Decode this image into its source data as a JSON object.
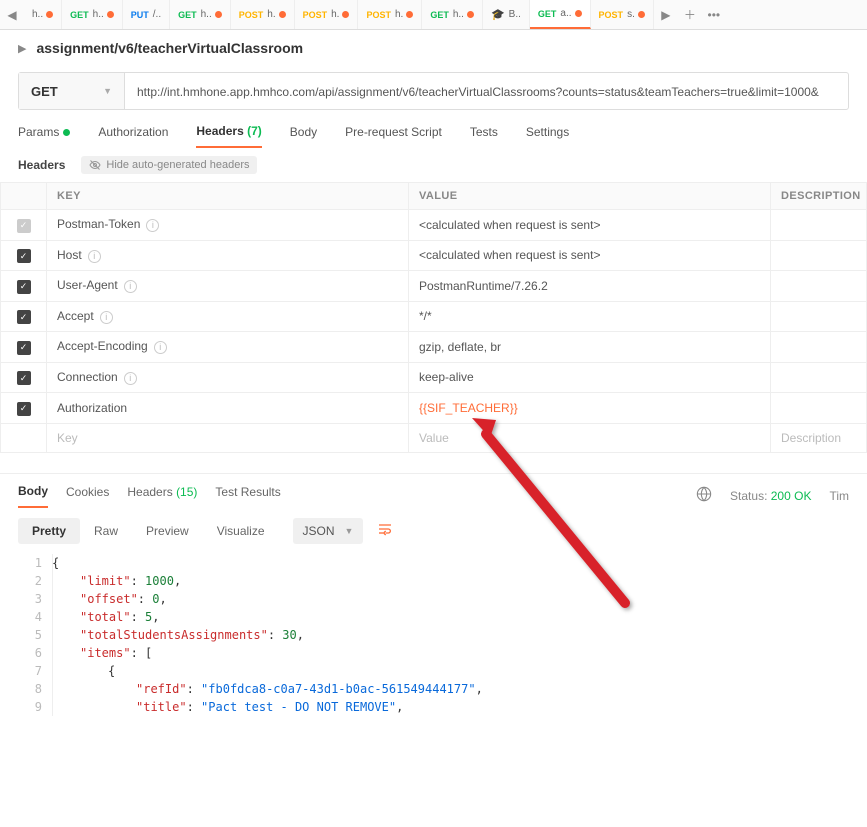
{
  "topTabs": [
    {
      "method": "",
      "methodClass": "",
      "label": "h..",
      "dot": true,
      "hat": false,
      "nav": true,
      "dir": "◀"
    },
    {
      "method": "GET",
      "methodClass": "get",
      "label": "h..",
      "dot": true
    },
    {
      "method": "PUT",
      "methodClass": "put",
      "label": "/..",
      "dot": false
    },
    {
      "method": "GET",
      "methodClass": "get",
      "label": "h..",
      "dot": true
    },
    {
      "method": "POST",
      "methodClass": "post",
      "label": "h.",
      "dot": true
    },
    {
      "method": "POST",
      "methodClass": "post",
      "label": "h.",
      "dot": true
    },
    {
      "method": "POST",
      "methodClass": "post",
      "label": "h.",
      "dot": true
    },
    {
      "method": "GET",
      "methodClass": "get",
      "label": "h..",
      "dot": true
    },
    {
      "method": "",
      "methodClass": "",
      "label": "B..",
      "dot": false,
      "hat": true
    },
    {
      "method": "GET",
      "methodClass": "get",
      "label": "a..",
      "dot": true,
      "active": true
    },
    {
      "method": "POST",
      "methodClass": "post",
      "label": "s.",
      "dot": true
    }
  ],
  "topControls": {
    "run": "▶",
    "plus": "＋",
    "more": "•••"
  },
  "requestTitle": "assignment/v6/teacherVirtualClassroom",
  "method": "GET",
  "url": "http://int.hmhone.app.hmhco.com/api/assignment/v6/teacherVirtualClassrooms?counts=status&teamTeachers=true&limit=1000&",
  "sectionTabs": {
    "params": "Params",
    "auth": "Authorization",
    "headers": "Headers",
    "headersCount": "(7)",
    "body": "Body",
    "pre": "Pre-request Script",
    "tests": "Tests",
    "settings": "Settings"
  },
  "headersBar": {
    "label": "Headers",
    "hide": "Hide auto-generated headers"
  },
  "tableHead": {
    "key": "KEY",
    "value": "VALUE",
    "desc": "DESCRIPTION"
  },
  "headers": [
    {
      "on": "grey",
      "key": "Postman-Token",
      "info": true,
      "value": "<calculated when request is sent>"
    },
    {
      "on": "on",
      "key": "Host",
      "info": true,
      "value": "<calculated when request is sent>"
    },
    {
      "on": "on",
      "key": "User-Agent",
      "info": true,
      "value": "PostmanRuntime/7.26.2"
    },
    {
      "on": "on",
      "key": "Accept",
      "info": true,
      "value": "*/*"
    },
    {
      "on": "on",
      "key": "Accept-Encoding",
      "info": true,
      "value": "gzip, deflate, br"
    },
    {
      "on": "on",
      "key": "Connection",
      "info": true,
      "value": "keep-alive"
    },
    {
      "on": "on",
      "key": "Authorization",
      "info": false,
      "value": "{{SIF_TEACHER}}",
      "var": true
    }
  ],
  "placeholders": {
    "key": "Key",
    "value": "Value",
    "desc": "Description"
  },
  "responseTabs": {
    "body": "Body",
    "cookies": "Cookies",
    "headers": "Headers",
    "headersCount": "(15)",
    "tests": "Test Results"
  },
  "responseStatus": {
    "label": "Status:",
    "value": "200 OK",
    "time": "Tim"
  },
  "bodyViews": {
    "pretty": "Pretty",
    "raw": "Raw",
    "preview": "Preview",
    "visualize": "Visualize",
    "format": "JSON"
  },
  "json": {
    "limit": 1000,
    "offset": 0,
    "total": 5,
    "totalStudentsAssignments": 30,
    "firstItem": {
      "refId": "fb0fdca8-c0a7-43d1-b0ac-561549444177",
      "title": "Pact test - DO NOT REMOVE"
    }
  }
}
